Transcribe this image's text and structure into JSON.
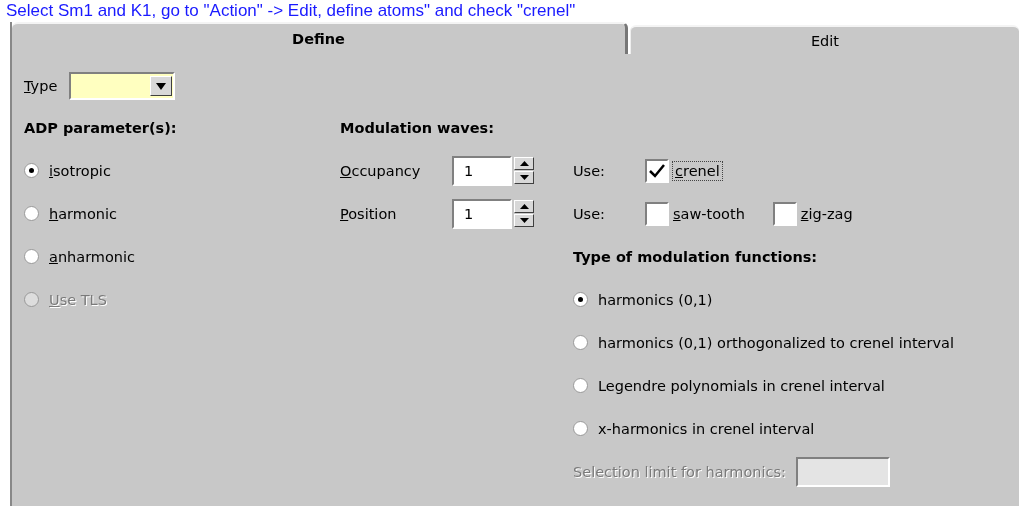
{
  "caption": "Select Sm1 and K1, go to \"Action\" -> Edit, define atoms\" and check \"crenel\"",
  "tabs": [
    {
      "label": "Define",
      "selected": true
    },
    {
      "label": "Edit",
      "selected": false
    }
  ],
  "type_field": {
    "label": "Type",
    "mnemonic": true
  },
  "adp": {
    "heading": "ADP parameter(s):",
    "options": [
      {
        "label": "isotropic",
        "selected": true,
        "disabled": false,
        "mnemonic": true
      },
      {
        "label": "harmonic",
        "selected": false,
        "disabled": false,
        "mnemonic": true
      },
      {
        "label": "anharmonic",
        "selected": false,
        "disabled": false,
        "mnemonic": true
      },
      {
        "label": "Use TLS",
        "selected": false,
        "disabled": true,
        "mnemonic": true
      }
    ]
  },
  "modulation_waves": {
    "heading": "Modulation waves:",
    "rows": [
      {
        "label": "Occupancy",
        "mnemonic": true,
        "value": "1",
        "use_label": "Use:",
        "checks": [
          {
            "label": "crenel",
            "checked": true,
            "focused": true,
            "mnemonic": true
          }
        ]
      },
      {
        "label": "Position",
        "mnemonic": true,
        "value": "1",
        "use_label": "Use:",
        "checks": [
          {
            "label": "saw-tooth",
            "checked": false,
            "focused": false,
            "mnemonic": true
          },
          {
            "label": "zig-zag",
            "checked": false,
            "focused": false,
            "mnemonic": true
          }
        ]
      }
    ]
  },
  "function_type": {
    "heading": "Type of modulation functions:",
    "options": [
      {
        "label": "harmonics (0,1)",
        "selected": true,
        "disabled": false,
        "mnemonic": false
      },
      {
        "label": "harmonics (0,1) orthogonalized to crenel interval",
        "selected": false,
        "disabled": false,
        "mnemonic": false
      },
      {
        "label": "Legendre polynomials in crenel interval",
        "selected": false,
        "disabled": false,
        "mnemonic": false
      },
      {
        "label": "x-harmonics in crenel interval",
        "selected": false,
        "disabled": false,
        "mnemonic": false
      }
    ],
    "selection_limit": {
      "label": "Selection limit for harmonics:",
      "disabled": true
    }
  }
}
